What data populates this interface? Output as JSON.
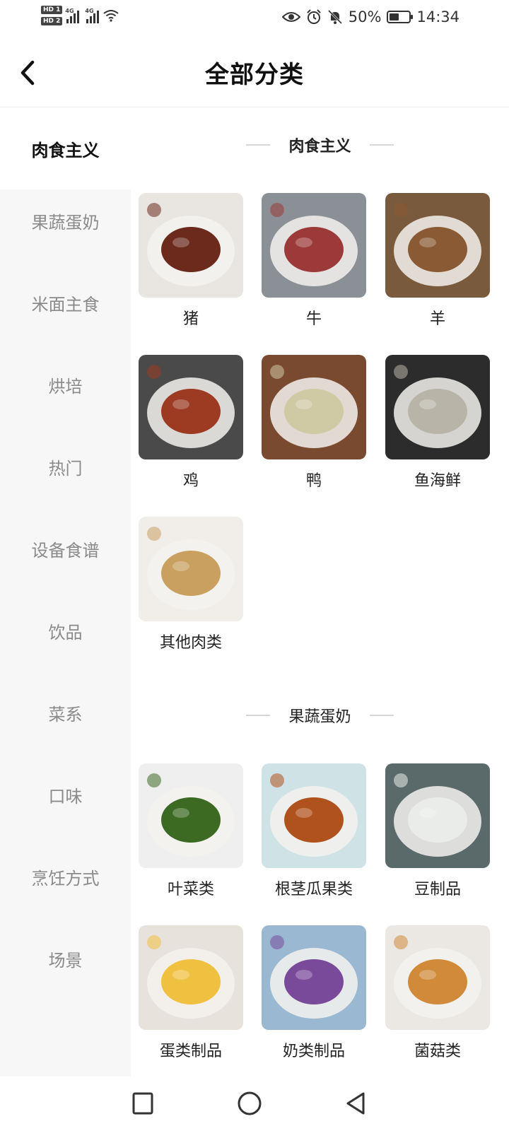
{
  "status_bar": {
    "hd1": "HD 1",
    "hd2": "HD 2",
    "net1": "4G",
    "net2": "4G",
    "battery_text": "50%",
    "battery_level": 0.5,
    "time": "14:34"
  },
  "header": {
    "title": "全部分类",
    "back_icon": "chevron-left-icon"
  },
  "sidebar": {
    "items": [
      {
        "label": "肉食主义",
        "active": true
      },
      {
        "label": "果蔬蛋奶",
        "active": false
      },
      {
        "label": "米面主食",
        "active": false
      },
      {
        "label": "烘培",
        "active": false
      },
      {
        "label": "热门",
        "active": false
      },
      {
        "label": "设备食谱",
        "active": false
      },
      {
        "label": "饮品",
        "active": false
      },
      {
        "label": "菜系",
        "active": false
      },
      {
        "label": "口味",
        "active": false
      },
      {
        "label": "烹饪方式",
        "active": false
      },
      {
        "label": "场景",
        "active": false
      }
    ]
  },
  "sections": [
    {
      "title": "肉食主义",
      "items": [
        {
          "label": "猪",
          "colors": [
            "#e9e6e2",
            "#6b2a1c"
          ]
        },
        {
          "label": "牛",
          "colors": [
            "#8a9095",
            "#9b3a38"
          ]
        },
        {
          "label": "羊",
          "colors": [
            "#7a5a3c",
            "#8a5a34"
          ]
        },
        {
          "label": "鸡",
          "colors": [
            "#4a4a4a",
            "#9c3a22"
          ]
        },
        {
          "label": "鸭",
          "colors": [
            "#7a4a30",
            "#cfc9a4"
          ]
        },
        {
          "label": "鱼海鲜",
          "colors": [
            "#2c2c2c",
            "#b8b4a8"
          ]
        },
        {
          "label": "其他肉类",
          "colors": [
            "#f1eeea",
            "#c9a060"
          ]
        }
      ]
    },
    {
      "title": "果蔬蛋奶",
      "items": [
        {
          "label": "叶菜类",
          "colors": [
            "#efefef",
            "#3d6a22"
          ]
        },
        {
          "label": "根茎瓜果类",
          "colors": [
            "#cfe3e6",
            "#b0521e"
          ]
        },
        {
          "label": "豆制品",
          "colors": [
            "#5a6a6a",
            "#e9ece8"
          ]
        },
        {
          "label": "蛋类制品",
          "colors": [
            "#e8e2dc",
            "#f0c040"
          ]
        },
        {
          "label": "奶类制品",
          "colors": [
            "#9ab8d2",
            "#7a4a9a"
          ]
        },
        {
          "label": "菌菇类",
          "colors": [
            "#ebe7e2",
            "#d08a3a"
          ]
        }
      ]
    }
  ],
  "nav_bar": {
    "recents_icon": "square-icon",
    "home_icon": "circle-icon",
    "back_icon": "triangle-back-icon"
  }
}
